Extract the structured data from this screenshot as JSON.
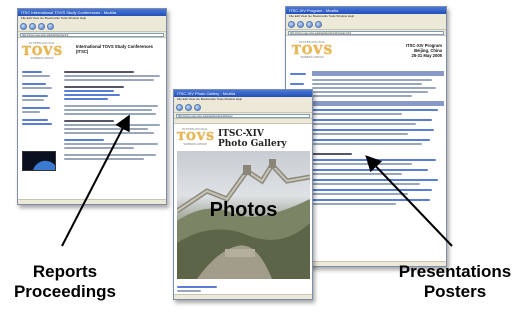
{
  "windows": {
    "left": {
      "title": "ITSC International TOVS Study Conferences - Mozilla",
      "menu": "File  Edit  View  Go  Bookmarks  Tools  Window  Help",
      "address": "http://cimss.ssec.wisc.edu/itwg/itsc/itsc14/",
      "page_title": "International TOVS Study Conferences (ITSC)",
      "logo_top": "INTERNATIONAL",
      "logo_big": "TOVS",
      "logo_bottom": "WORKING GROUP"
    },
    "center": {
      "title": "ITSC-XIV Photo Gallery - Mozilla",
      "menu": "File  Edit  View  Go  Bookmarks  Tools  Window  Help",
      "address": "http://cimss.ssec.wisc.edu/itwg/itsc/itsc14/photos/",
      "gallery_line1": "ITSC-XIV",
      "gallery_line2": "Photo Gallery",
      "overlay_label": "Photos",
      "logo_top": "INTERNATIONAL",
      "logo_big": "TOVS",
      "logo_bottom": "WORKING GROUP"
    },
    "right": {
      "title": "ITSC-XIV Program - Mozilla",
      "menu": "File  Edit  View  Go  Bookmarks  Tools  Window  Help",
      "address": "http://cimss.ssec.wisc.edu/itwg/itsc/itsc14/program.html",
      "page_title_1": "ITSC-XIV Program",
      "page_title_2": "Beijing, China",
      "page_title_3": "25-31 May 2005",
      "logo_top": "INTERNATIONAL",
      "logo_big": "TOVS",
      "logo_bottom": "WORKING GROUP"
    }
  },
  "labels": {
    "left_line1": "Reports",
    "left_line2": "Proceedings",
    "right_line1": "Presentations",
    "right_line2": "Posters"
  },
  "colors": {
    "titlebar": "#2250b8",
    "chrome": "#ece9d8",
    "logo_gold": "#e8b84a",
    "link_blue": "#5a7ed4"
  }
}
